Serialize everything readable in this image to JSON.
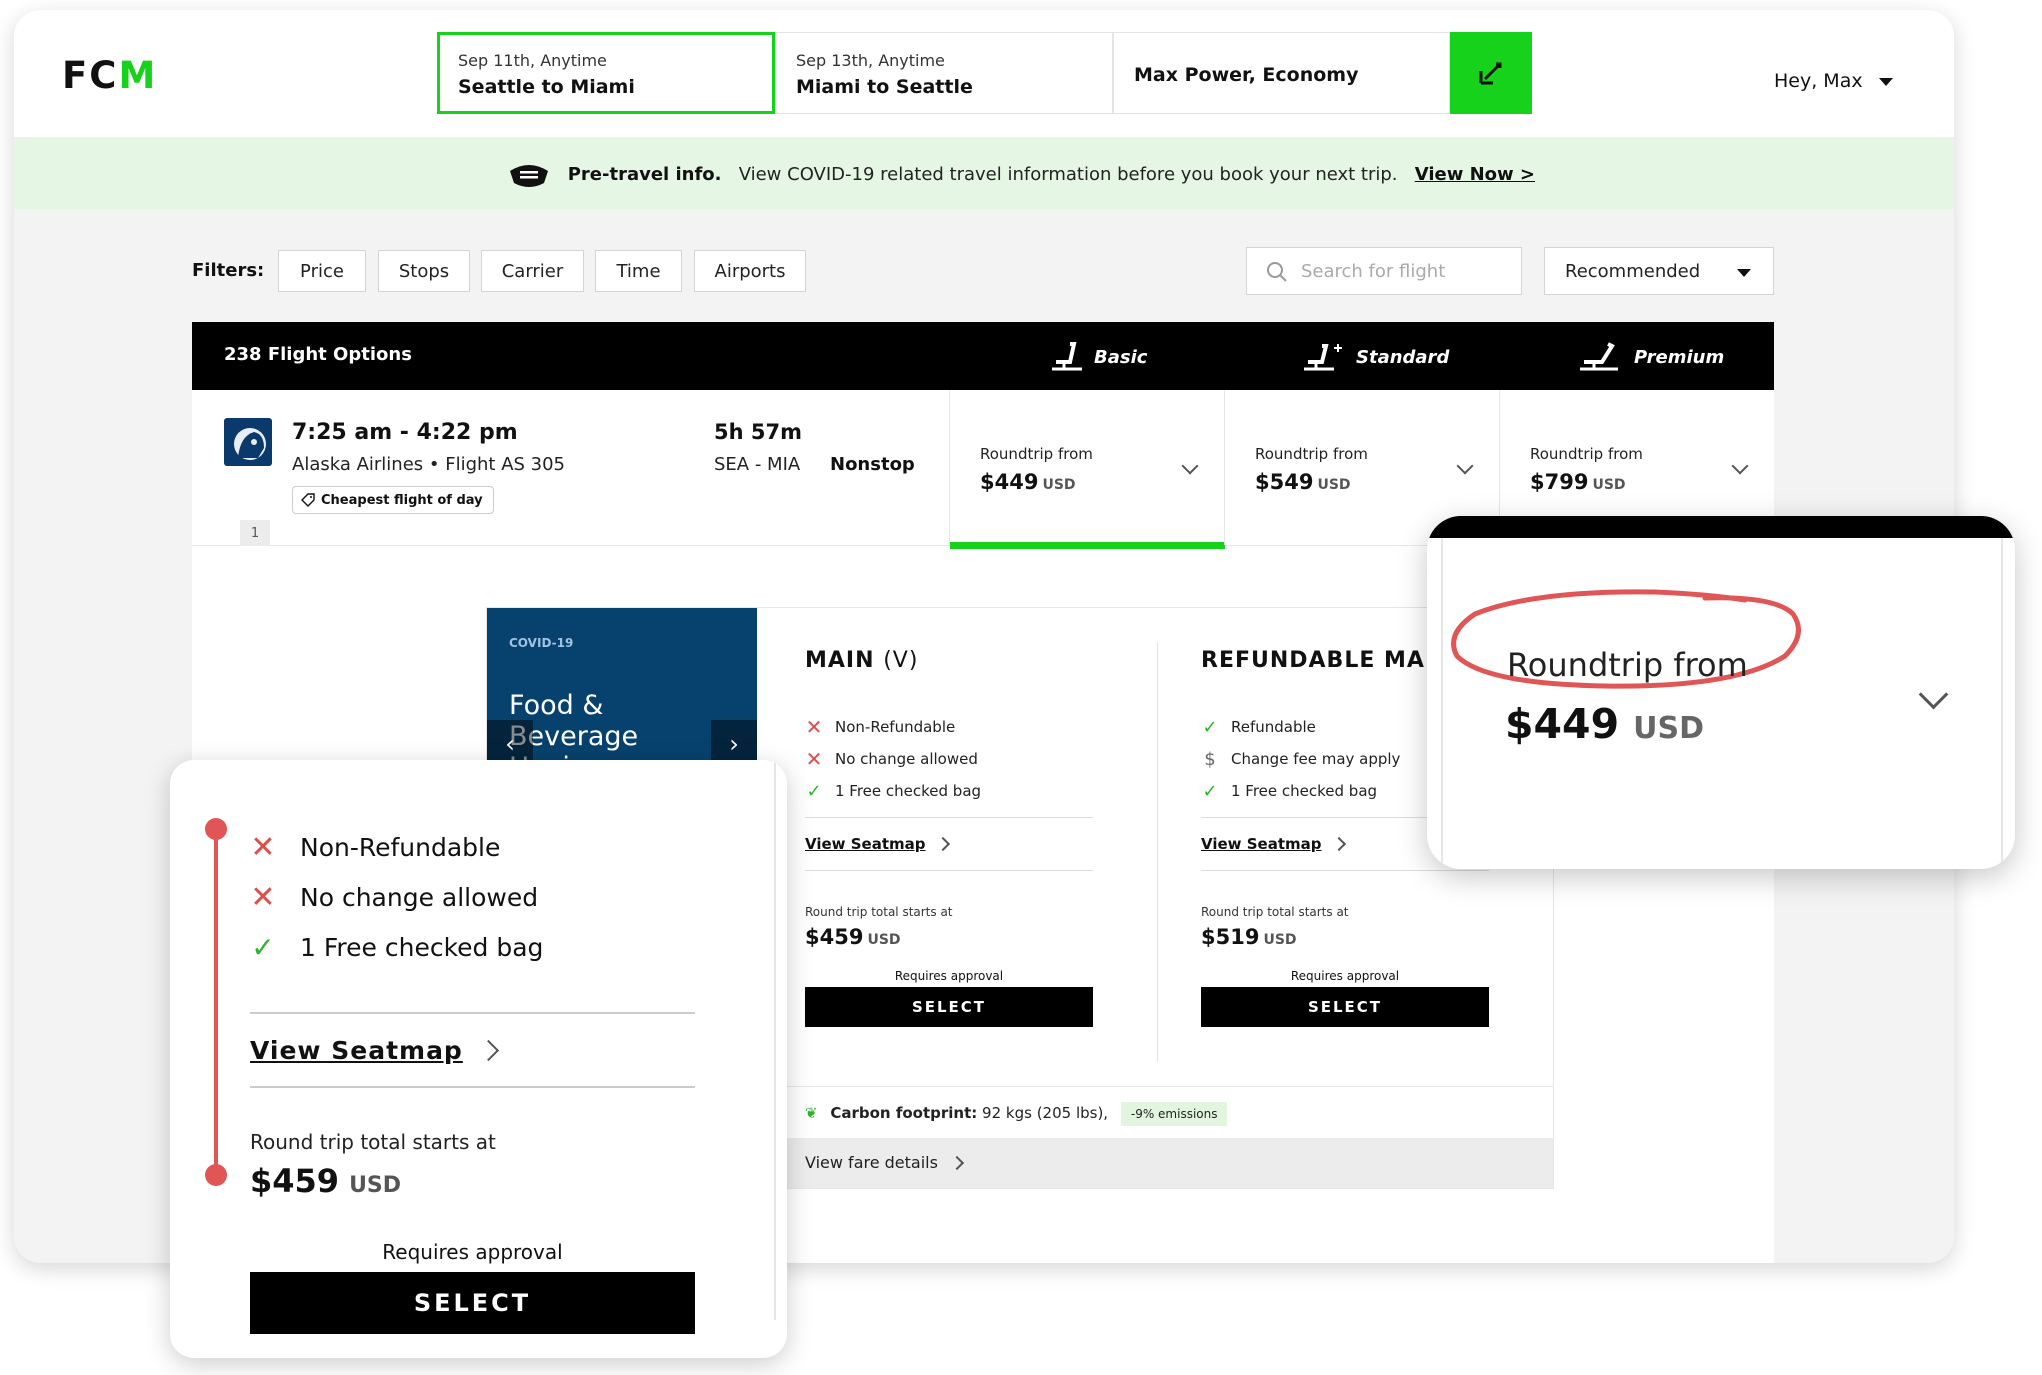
{
  "header": {
    "logo": {
      "prefix": "FC",
      "suffix": "M"
    },
    "segments": [
      {
        "date": "Sep 11th, Anytime",
        "route": "Seattle to Miami"
      },
      {
        "date": "Sep 13th, Anytime",
        "route": "Miami to Seattle"
      }
    ],
    "traveler": "Max Power, Economy",
    "greeting": "Hey, Max"
  },
  "banner": {
    "title": "Pre-travel info.",
    "text": "View COVID-19 related travel information before you book your next trip.",
    "link": "View Now >"
  },
  "filters": {
    "label": "Filters:",
    "buttons": [
      "Price",
      "Stops",
      "Carrier",
      "Time",
      "Airports"
    ],
    "search_placeholder": "Search for flight",
    "sort_value": "Recommended"
  },
  "results": {
    "count_label": "238 Flight Options",
    "fare_headers": [
      "Basic",
      "Standard",
      "Premium"
    ],
    "flight": {
      "time": "7:25 am - 4:22 pm",
      "airline": "Alaska Airlines • Flight AS 305",
      "tag": "Cheapest flight of day",
      "index": "1",
      "duration": "5h 57m",
      "route": "SEA - MIA",
      "stops": "Nonstop",
      "fares": [
        {
          "label": "Roundtrip from",
          "price": "$449",
          "currency": "USD"
        },
        {
          "label": "Roundtrip from",
          "price": "$549",
          "currency": "USD"
        },
        {
          "label": "Roundtrip from",
          "price": "$799",
          "currency": "USD"
        }
      ]
    }
  },
  "panel": {
    "covid": {
      "tag": "COVID-19",
      "title": "Food & Beverage Hygiene"
    },
    "fares": [
      {
        "name": "MAIN",
        "code": "(V)",
        "features": [
          {
            "icon": "x-icon",
            "text": "Non-Refundable"
          },
          {
            "icon": "x-icon",
            "text": "No change allowed"
          },
          {
            "icon": "check-icon",
            "text": "1 Free checked bag"
          }
        ],
        "seatmap": "View Seatmap",
        "total_label": "Round trip total starts at",
        "total_price": "$459",
        "currency": "USD",
        "approval": "Requires approval",
        "select": "SELECT"
      },
      {
        "name": "REFUNDABLE MAIN",
        "code": "",
        "features": [
          {
            "icon": "check-icon",
            "text": "Refundable"
          },
          {
            "icon": "dollar-icon",
            "text": "Change fee may apply"
          },
          {
            "icon": "check-icon",
            "text": "1 Free checked bag"
          }
        ],
        "seatmap": "View Seatmap",
        "total_label": "Round trip total starts at",
        "total_price": "$519",
        "currency": "USD",
        "approval": "Requires approval",
        "select": "SELECT"
      }
    ],
    "carbon": {
      "label": "Carbon footprint:",
      "value": "92 kgs (205 lbs),",
      "badge": "-9% emissions"
    },
    "fare_details": "View fare details"
  },
  "zoom_left": {
    "features": [
      {
        "icon": "x-icon",
        "text": "Non-Refundable"
      },
      {
        "icon": "x-icon",
        "text": "No change allowed"
      },
      {
        "icon": "check-icon",
        "text": "1 Free checked bag"
      }
    ],
    "seatmap": "View Seatmap",
    "total_label": "Round trip total starts at",
    "total_price": "$459",
    "currency": "USD",
    "approval": "Requires approval",
    "select": "SELECT"
  },
  "zoom_right": {
    "label": "Roundtrip from",
    "price": "$449",
    "currency": "USD"
  },
  "colors": {
    "accent": "#16d21a",
    "highlight_red": "#e05555",
    "dark": "#000000",
    "covid_blue": "#07426e"
  }
}
